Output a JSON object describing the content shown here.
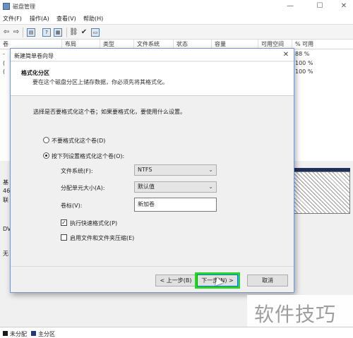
{
  "window": {
    "title": "磁盘管理",
    "min_icon": "minimize-icon",
    "max_icon": "maximize-icon",
    "close_icon": "close-icon"
  },
  "menu": [
    "文件(F)",
    "操作(A)",
    "查看(V)",
    "帮助(H)"
  ],
  "columns": [
    "卷",
    "布局",
    "类型",
    "文件系统",
    "状态",
    "容量",
    "可用空间",
    "% 可用"
  ],
  "volumes": [
    {
      "name": "-",
      "pct": "88 %"
    },
    {
      "name": "(",
      "pct": "100 %"
    },
    {
      "name": "(",
      "pct": "100 %"
    }
  ],
  "disks": [
    {
      "label": "基"
    },
    {
      "label": "46"
    },
    {
      "label": "联"
    },
    {
      "label": "DV"
    },
    {
      "label": "无"
    }
  ],
  "legend": {
    "unallocated": "未分配",
    "primary": "主分区",
    "unallocated_color": "#1a1a1a",
    "primary_color": "#1f3a7a"
  },
  "dialog": {
    "title": "新建简单卷向导",
    "heading": "格式化分区",
    "subtitle": "要在这个磁盘分区上储存数据，你必须先将其格式化。",
    "prompt": "选择是否要格式化这个卷；如果要格式化，要使用什么设置。",
    "option_no_format": "不要格式化这个卷(D)",
    "option_format": "按下列设置格式化这个卷(O):",
    "fs_label": "文件系统(F):",
    "fs_value": "NTFS",
    "alloc_label": "分配单元大小(A):",
    "alloc_value": "默认值",
    "vol_label_label": "卷标(V):",
    "vol_label_value": "新加卷",
    "quick_format": "执行快速格式化(P)",
    "compression": "启用文件和文件夹压缩(E)",
    "quick_format_checked": true,
    "compression_checked": false,
    "back_button": "< 上一步(B)",
    "next_button": "下一步(N) >",
    "cancel_button": "取消"
  },
  "watermark": "软件技巧"
}
